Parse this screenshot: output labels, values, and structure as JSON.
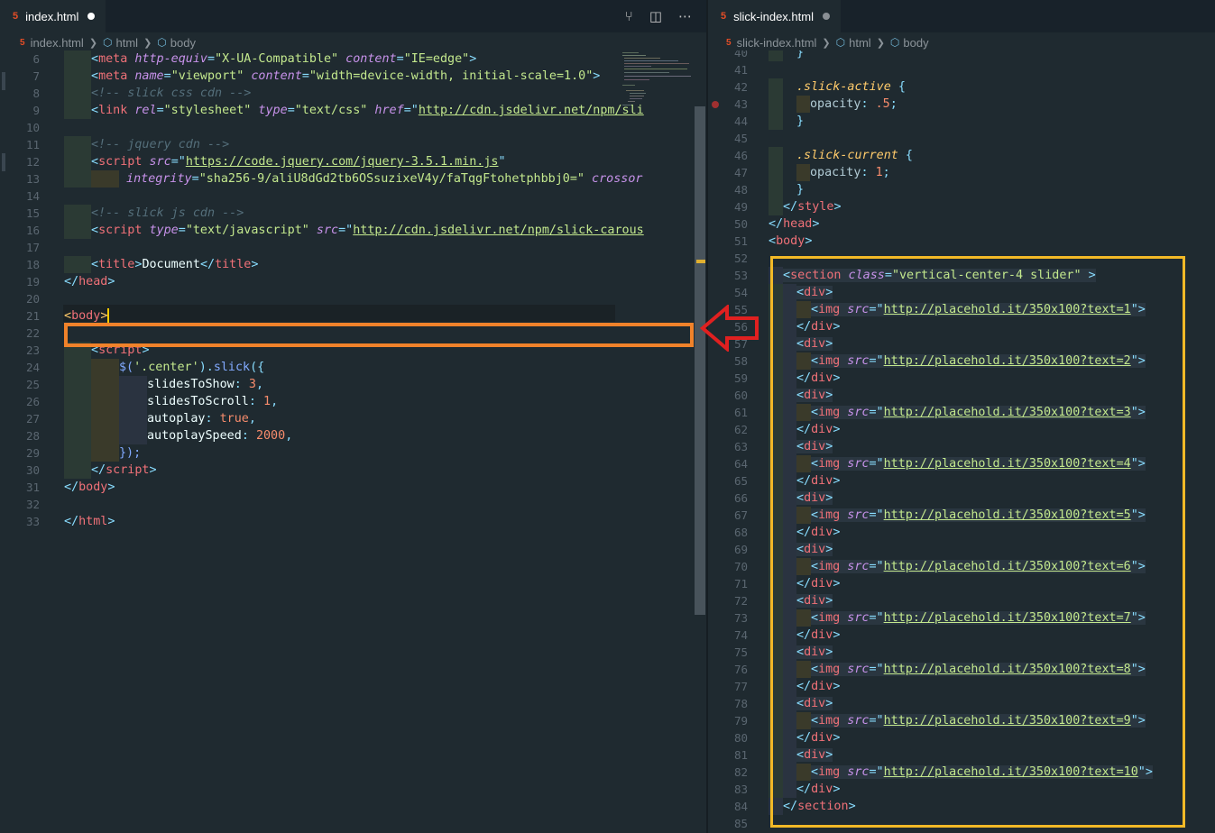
{
  "left": {
    "tab": {
      "icon": "html5-icon",
      "label": "index.html",
      "modified": true
    },
    "breadcrumb": [
      "index.html",
      "html",
      "body"
    ],
    "actions": [
      "source-control-compare-icon",
      "split-editor-icon",
      "more-actions-icon"
    ],
    "line_numbers": [
      "6",
      "7",
      "8",
      "9",
      "10",
      "11",
      "12",
      "13",
      "14",
      "15",
      "16",
      "17",
      "18",
      "19",
      "20",
      "21",
      "22",
      "23",
      "24",
      "25",
      "26",
      "27",
      "28",
      "29",
      "30",
      "31",
      "32",
      "33"
    ],
    "lines": {
      "l6": [
        "<",
        "meta",
        " http-equiv",
        "=",
        "\"X-UA-Compatible\"",
        " content",
        "=",
        "\"IE=edge\"",
        ">"
      ],
      "l7": [
        "<",
        "meta",
        " name",
        "=",
        "\"viewport\"",
        " content",
        "=",
        "\"width=device-width, initial-scale=1.0\"",
        ">"
      ],
      "l8": "<!-- slick css cdn -->",
      "l9": [
        "<",
        "link",
        " rel",
        "=",
        "\"stylesheet\"",
        " type",
        "=",
        "\"text/css\"",
        " href",
        "=\"",
        "http://cdn.jsdelivr.net/npm/sli"
      ],
      "l11": "<!-- jquery cdn -->",
      "l12": [
        "<",
        "script",
        " src",
        "=\"",
        "https://code.jquery.com/jquery-3.5.1.min.js",
        "\""
      ],
      "l13": [
        " integrity",
        "=",
        "\"sha256-9/aliU8dGd2tb6OSsuzixeV4y/faTqgFtohetphbbj0=\"",
        " crossor"
      ],
      "l15": "<!-- slick js cdn -->",
      "l16": [
        "<",
        "script",
        " type",
        "=",
        "\"text/javascript\"",
        " src",
        "=\"",
        "http://cdn.jsdelivr.net/npm/slick-carous"
      ],
      "l18": [
        "<",
        "title",
        ">",
        "Document",
        "</",
        "title",
        ">"
      ],
      "l19": [
        "</",
        "head",
        ">"
      ],
      "l21": [
        "<",
        "body",
        ">"
      ],
      "l23": [
        "<",
        "script",
        ">"
      ],
      "l24": [
        "$(",
        "'.center'",
        ").",
        "slick",
        "({"
      ],
      "l25": [
        "slidesToShow",
        ": ",
        "3",
        ","
      ],
      "l26": [
        "slidesToScroll",
        ": ",
        "1",
        ","
      ],
      "l27": [
        "autoplay",
        ": ",
        "true",
        ","
      ],
      "l28": [
        "autoplaySpeed",
        ": ",
        "2000",
        ","
      ],
      "l29": [
        "});"
      ],
      "l30": [
        "</",
        "script",
        ">"
      ],
      "l31": [
        "</",
        "body",
        ">"
      ],
      "l33": [
        "</",
        "html",
        ">"
      ]
    }
  },
  "right": {
    "tab": {
      "icon": "html5-icon",
      "label": "slick-index.html",
      "modified": true
    },
    "breadcrumb": [
      "slick-index.html",
      "html",
      "body"
    ],
    "line_numbers": [
      "40",
      "41",
      "42",
      "43",
      "44",
      "45",
      "46",
      "47",
      "48",
      "49",
      "50",
      "51",
      "52",
      "53",
      "54",
      "55",
      "56",
      "57",
      "58",
      "59",
      "60",
      "61",
      "62",
      "63",
      "64",
      "65",
      "66",
      "67",
      "68",
      "69",
      "70",
      "71",
      "72",
      "73",
      "74",
      "75",
      "76",
      "77",
      "78",
      "79",
      "80",
      "81",
      "82",
      "83",
      "84",
      "85"
    ],
    "css": {
      "brace_close": "}",
      "sel1": ".slick-active",
      "open": " {",
      "prop1": "opacity",
      "val1": ".5",
      "sel2": ".slick-current",
      "prop2": "opacity",
      "val2": "1",
      "colon": ": ",
      "semi": ";"
    },
    "tags": {
      "style_close": [
        "</",
        "style",
        ">"
      ],
      "head_close": [
        "</",
        "head",
        ">"
      ],
      "body_open": [
        "<",
        "body",
        ">"
      ],
      "section_open": [
        "<",
        "section",
        " class",
        "=",
        "\"vertical-center-4 slider\"",
        " >"
      ],
      "div_open": [
        "<",
        "div",
        ">"
      ],
      "div_close": [
        "</",
        "div",
        ">"
      ],
      "img_prefix": [
        "<",
        "img",
        " src",
        "=\"",
        "\">"
      ],
      "section_close": [
        "</",
        "section",
        ">"
      ]
    },
    "img_urls": [
      "http://placehold.it/350x100?text=1",
      "http://placehold.it/350x100?text=2",
      "http://placehold.it/350x100?text=3",
      "http://placehold.it/350x100?text=4",
      "http://placehold.it/350x100?text=5",
      "http://placehold.it/350x100?text=6",
      "http://placehold.it/350x100?text=7",
      "http://placehold.it/350x100?text=8",
      "http://placehold.it/350x100?text=9",
      "http://placehold.it/350x100?text=10"
    ]
  },
  "annotations": {
    "orange_box_color": "#f0822a",
    "yellow_box_color": "#f2b927",
    "arrow_color": "#e02020",
    "arrow_icon": "left-arrow-icon"
  }
}
